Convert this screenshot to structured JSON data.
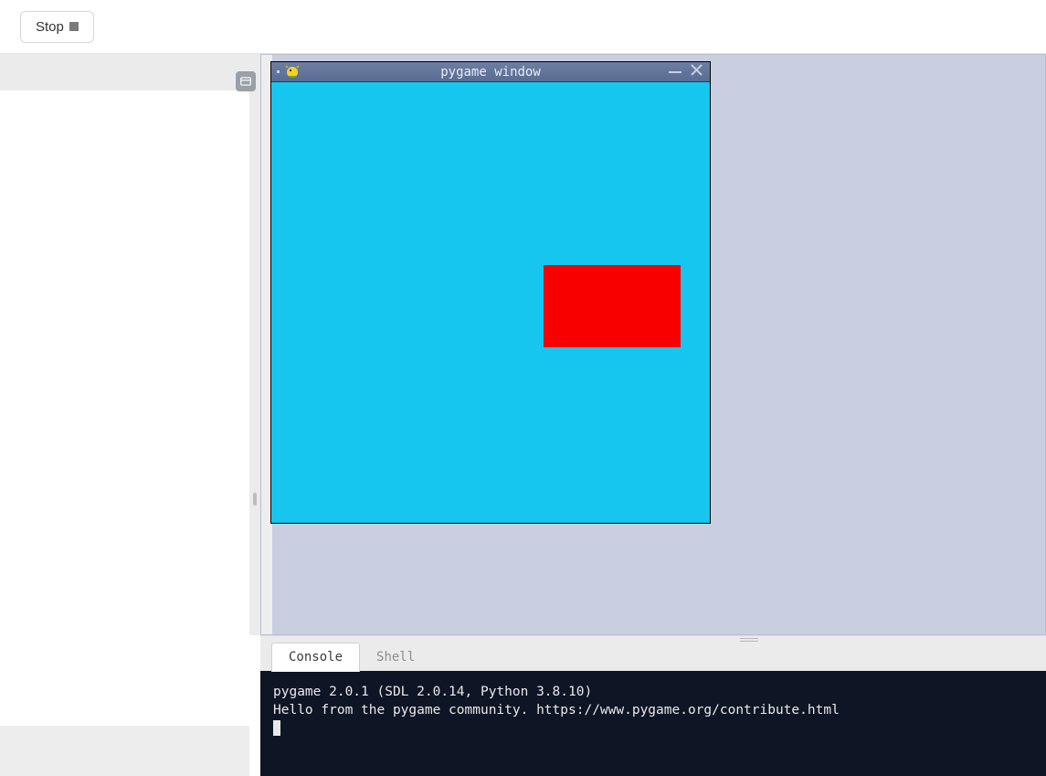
{
  "toolbar": {
    "stop_label": "Stop"
  },
  "pygame_window": {
    "title": "pygame window",
    "bg_color": "#16c6ef",
    "rect_color": "#f90000"
  },
  "tabs": {
    "console": "Console",
    "shell": "Shell"
  },
  "console": {
    "line1": "pygame 2.0.1 (SDL 2.0.14, Python 3.8.10)",
    "line2": "Hello from the pygame community. https://www.pygame.org/contribute.html"
  }
}
